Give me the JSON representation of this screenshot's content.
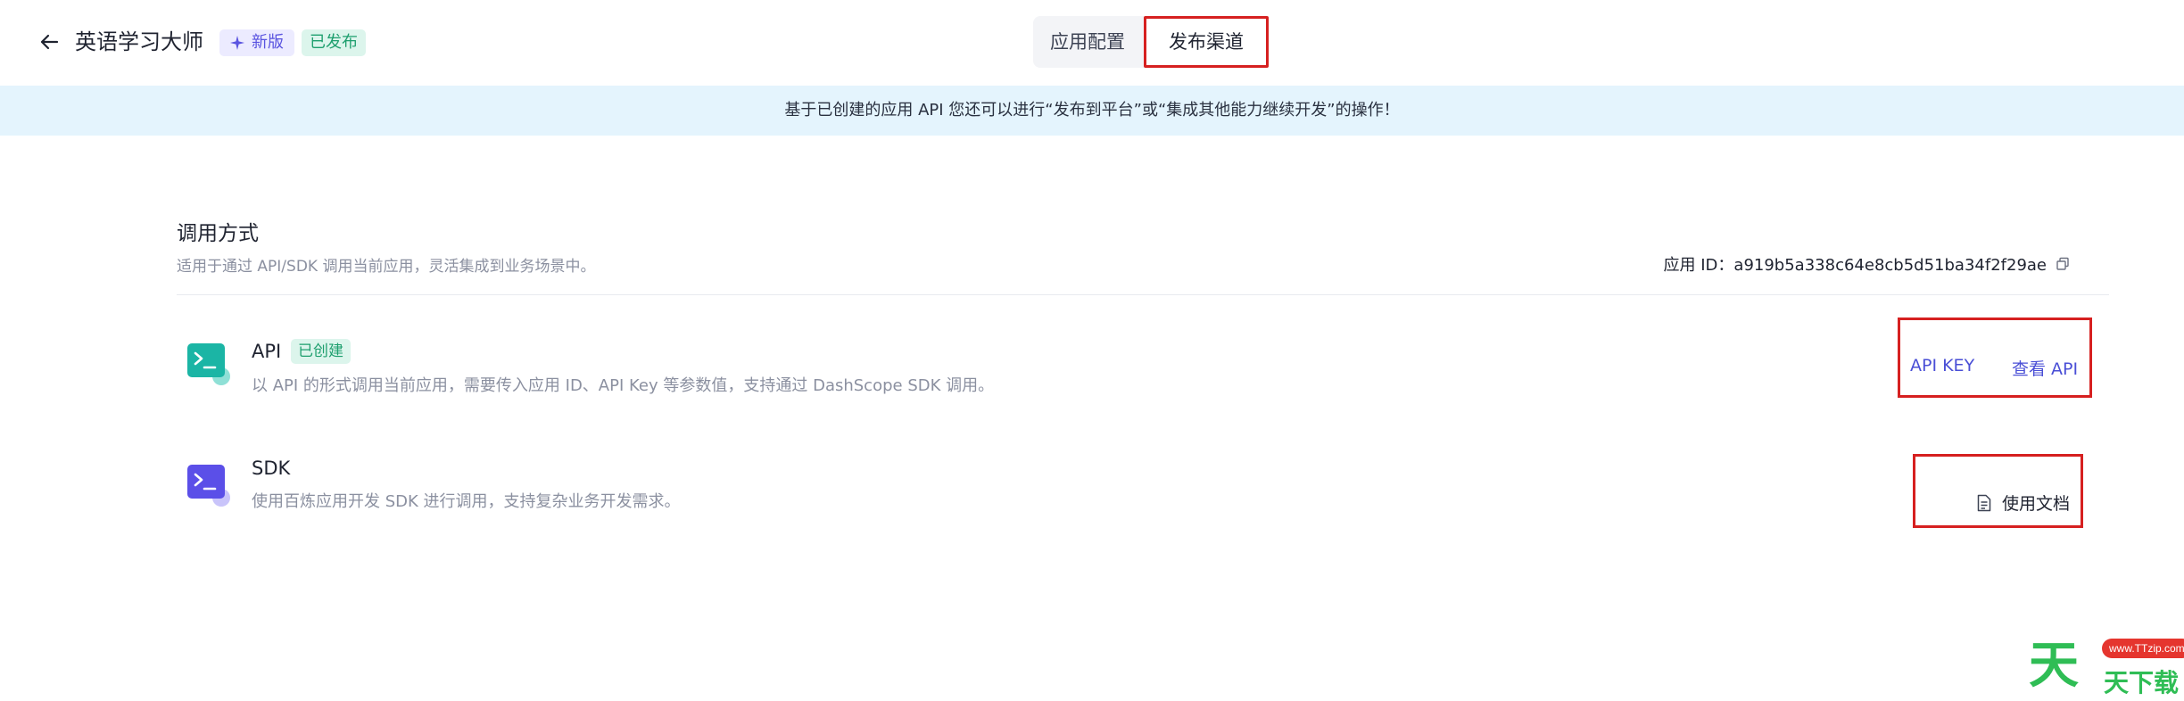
{
  "header": {
    "app_title": "英语学习大师",
    "badge_new": "新版",
    "badge_published": "已发布",
    "tabs": [
      {
        "label": "应用配置"
      },
      {
        "label": "发布渠道"
      }
    ]
  },
  "banner": {
    "text": "基于已创建的应用 API 您还可以进行“发布到平台”或“集成其他能力继续开发”的操作！"
  },
  "section": {
    "title": "调用方式",
    "description": "适用于通过 API/SDK 调用当前应用，灵活集成到业务场景中。",
    "app_id_label": "应用 ID：",
    "app_id_value": "a919b5a338c64e8cb5d51ba34f2f29ae"
  },
  "methods": [
    {
      "title": "API",
      "badge": "已创建",
      "description": "以 API 的形式调用当前应用，需要传入应用 ID、API Key 等参数值，支持通过 DashScope SDK 调用。",
      "actions": [
        "API KEY",
        "查看 API"
      ],
      "icon_color": "#1bb5a5"
    },
    {
      "title": "SDK",
      "description": "使用百炼应用开发 SDK 进行调用，支持复杂业务开发需求。",
      "actions": [
        "使用文档"
      ],
      "icon_color": "#5b4fe8"
    }
  ],
  "watermark": {
    "big": "天",
    "small": "天下载",
    "url": "www.TTzip.com"
  }
}
